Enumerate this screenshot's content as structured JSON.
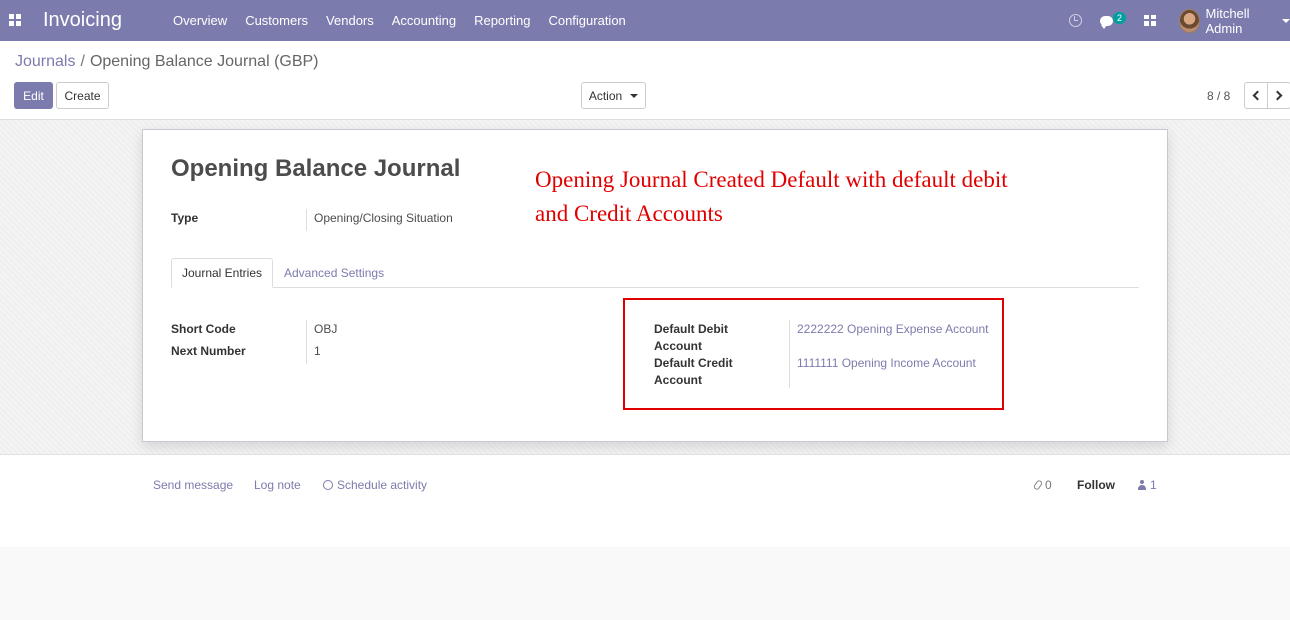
{
  "app": {
    "name": "Invoicing"
  },
  "menu": [
    "Overview",
    "Customers",
    "Vendors",
    "Accounting",
    "Reporting",
    "Configuration"
  ],
  "systray": {
    "messages_count": "2",
    "user_name": "Mitchell Admin"
  },
  "breadcrumb": {
    "parent": "Journals",
    "separator": "/",
    "current": "Opening Balance Journal (GBP)"
  },
  "buttons": {
    "edit": "Edit",
    "create": "Create",
    "action": "Action"
  },
  "pager": {
    "value": "8 / 8"
  },
  "form": {
    "title": "Opening Balance Journal",
    "type_label": "Type",
    "type_value": "Opening/Closing Situation",
    "tabs": [
      "Journal Entries",
      "Advanced Settings"
    ],
    "short_code_label": "Short Code",
    "short_code_value": "OBJ",
    "next_number_label": "Next Number",
    "next_number_value": "1",
    "default_debit_label_1": "Default Debit",
    "default_debit_label_2": "Account",
    "default_debit_value": "2222222 Opening Expense Account",
    "default_credit_label_1": "Default Credit",
    "default_credit_label_2": "Account",
    "default_credit_value": "1111111 Opening Income Account"
  },
  "annotation": {
    "line1": "Opening Journal Created Default with default debit",
    "line2": "and Credit Accounts"
  },
  "chatter": {
    "send_message": "Send message",
    "log_note": "Log note",
    "schedule_activity": "Schedule activity",
    "attachments_count": "0",
    "follow": "Follow",
    "followers_count": "1"
  },
  "colors": {
    "brand": "#7c7bad",
    "annotation": "#e00000"
  }
}
